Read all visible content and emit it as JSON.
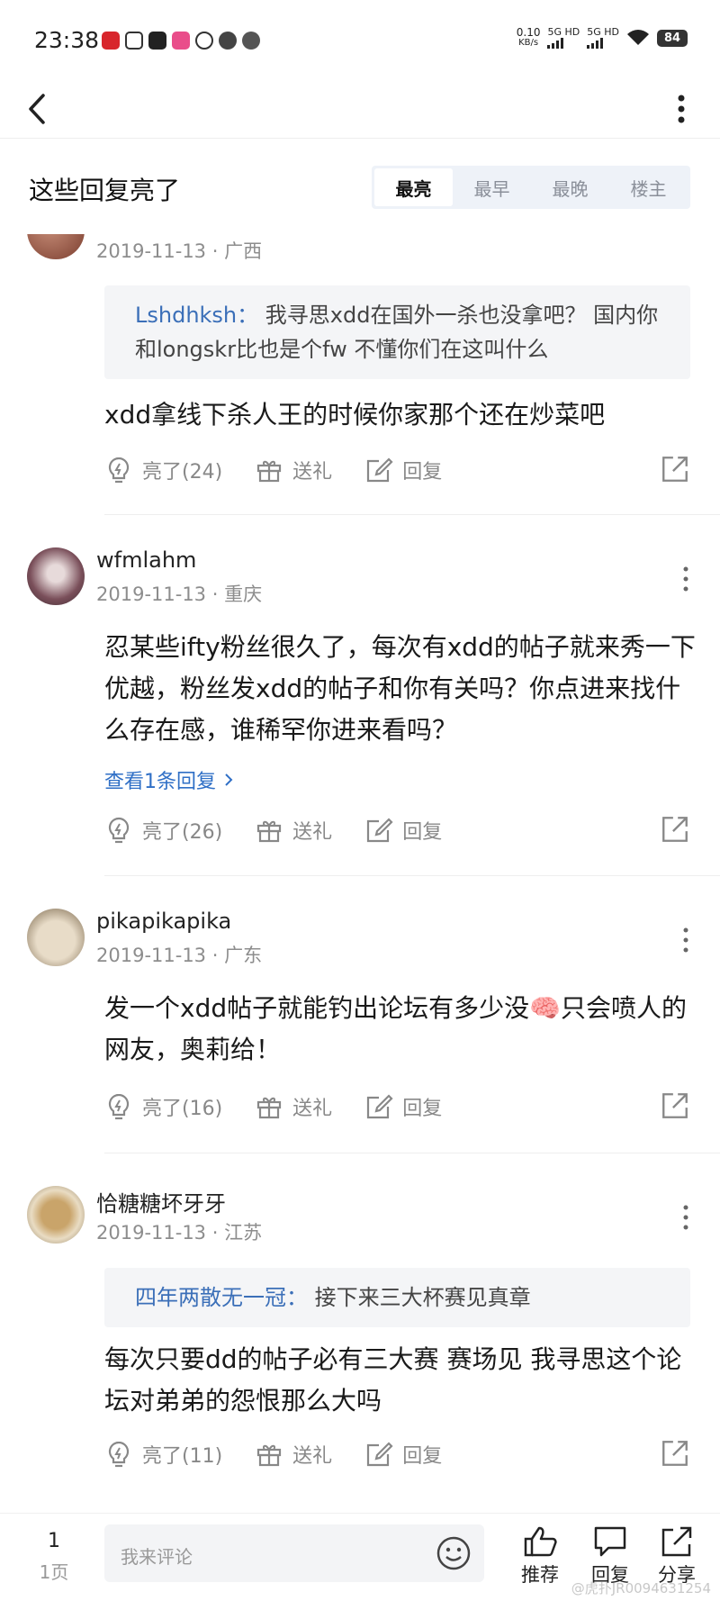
{
  "status_bar": {
    "time": "23:38",
    "net_speed_value": "0.10",
    "net_speed_unit": "KB/s",
    "signal1_label": "5G HD",
    "signal2_label": "5G HD",
    "battery": "84"
  },
  "section": {
    "title": "这些回复亮了",
    "sort_tabs": [
      {
        "label": "最亮",
        "active": true
      },
      {
        "label": "最早",
        "active": false
      },
      {
        "label": "最晚",
        "active": false
      },
      {
        "label": "楼主",
        "active": false
      }
    ]
  },
  "comments": [
    {
      "user": "",
      "date": "2019-11-13",
      "location": "广西",
      "quote_user": "Lshdhksh：",
      "quote_text": "我寻思xdd在国外一杀也没拿吧？ 国内你和longskr比也是个fw 不懂你们在这叫什么",
      "text": "xdd拿线下杀人王的时候你家那个还在炒菜吧",
      "likes": "亮了(24)",
      "gift": "送礼",
      "reply": "回复"
    },
    {
      "user": "wfmlahm",
      "date": "2019-11-13",
      "location": "重庆",
      "text": "忍某些ifty粉丝很久了，每次有xdd的帖子就来秀一下优越，粉丝发xdd的帖子和你有关吗？你点进来找什么存在感，谁稀罕你进来看吗？",
      "view_replies": "查看1条回复",
      "likes": "亮了(26)",
      "gift": "送礼",
      "reply": "回复"
    },
    {
      "user": "pikapikapika",
      "date": "2019-11-13",
      "location": "广东",
      "text_before_emoji": "发一个xdd帖子就能钓出论坛有多少没",
      "emoji": "🧠",
      "text_after_emoji": "只会喷人的网友，奥莉给！",
      "likes": "亮了(16)",
      "gift": "送礼",
      "reply": "回复"
    },
    {
      "user": "恰糖糖坏牙牙",
      "date": "2019-11-13",
      "location": "江苏",
      "quote_user": "四年两散无一冠：",
      "quote_text": "接下来三大杯赛见真章",
      "text": "每次只要dd的帖子必有三大赛 赛场见 我寻思这个论坛对弟弟的怨恨那么大吗",
      "likes": "亮了(11)",
      "gift": "送礼",
      "reply": "回复"
    }
  ],
  "bottom_bar": {
    "page_number": "1",
    "page_label": "1页",
    "comment_placeholder": "我来评论",
    "recommend_label": "推荐",
    "reply_label": "回复",
    "share_label": "分享",
    "watermark": "@虎扑JR0094631254"
  },
  "colors": {
    "link_blue": "#2f6fc6",
    "quote_name_blue": "#3b6fb8",
    "sort_tabs_bg": "#eef2f8",
    "quote_bg": "#f4f5f7"
  },
  "icons": [
    "back-arrow-icon",
    "more-vertical-icon",
    "bulb-like-icon",
    "gift-icon",
    "edit-reply-icon",
    "share-icon",
    "emoji-icon",
    "thumb-up-icon",
    "chat-bubble-icon"
  ]
}
